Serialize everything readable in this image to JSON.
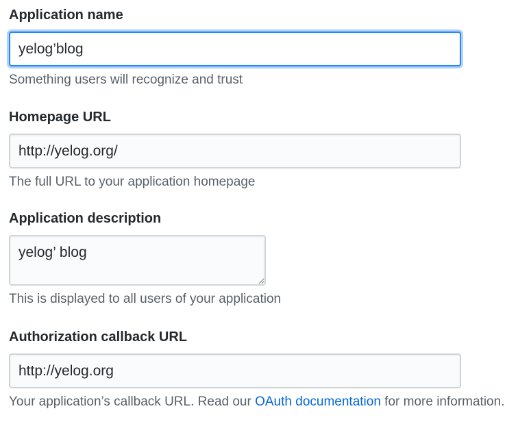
{
  "app_name": {
    "label": "Application name",
    "value": "yelog’blog",
    "note": "Something users will recognize and trust"
  },
  "homepage_url": {
    "label": "Homepage URL",
    "value": "http://yelog.org/",
    "note": "The full URL to your application homepage"
  },
  "description": {
    "label": "Application description",
    "value": "yelog’ blog",
    "note": "This is displayed to all users of your application"
  },
  "callback_url": {
    "label": "Authorization callback URL",
    "value": "http://yelog.org",
    "note_prefix": "Your application’s callback URL. Read our ",
    "note_link": "OAuth documentation",
    "note_suffix": " for more information."
  }
}
